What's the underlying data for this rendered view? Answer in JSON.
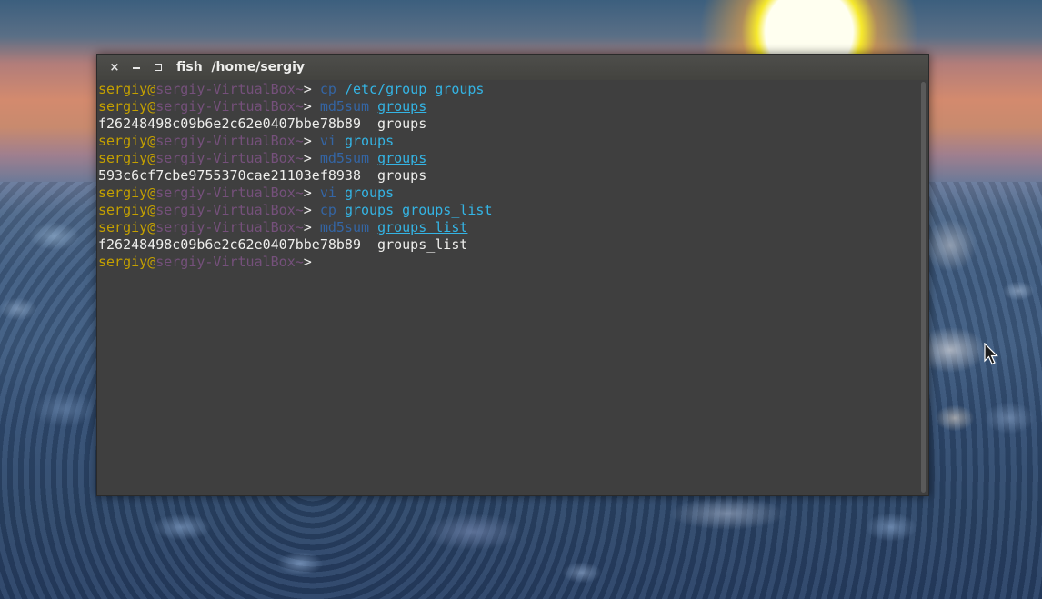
{
  "window": {
    "title_app": "fish",
    "title_path": "/home/sergiy",
    "close_label": "×"
  },
  "prompt": {
    "user": "sergiy",
    "at": "@",
    "host": "sergiy-VirtualBox",
    "tilde": "~",
    "symbol": ">"
  },
  "lines": [
    {
      "type": "cmd",
      "cmd": "cp",
      "args": [
        "/etc/group",
        "groups"
      ],
      "underline": [
        false,
        false
      ]
    },
    {
      "type": "cmd",
      "cmd": "md5sum",
      "args": [
        "groups"
      ],
      "underline": [
        true
      ]
    },
    {
      "type": "out",
      "text": "f26248498c09b6e2c62e0407bbe78b89  groups"
    },
    {
      "type": "cmd",
      "cmd": "vi",
      "args": [
        "groups"
      ],
      "underline": [
        false
      ]
    },
    {
      "type": "cmd",
      "cmd": "md5sum",
      "args": [
        "groups"
      ],
      "underline": [
        true
      ]
    },
    {
      "type": "out",
      "text": "593c6cf7cbe9755370cae21103ef8938  groups"
    },
    {
      "type": "cmd",
      "cmd": "vi",
      "args": [
        "groups"
      ],
      "underline": [
        false
      ]
    },
    {
      "type": "cmd",
      "cmd": "cp",
      "args": [
        "groups",
        "groups_list"
      ],
      "underline": [
        false,
        false
      ]
    },
    {
      "type": "cmd",
      "cmd": "md5sum",
      "args": [
        "groups_list"
      ],
      "underline": [
        true
      ]
    },
    {
      "type": "out",
      "text": "f26248498c09b6e2c62e0407bbe78b89  groups_list"
    },
    {
      "type": "prompt"
    }
  ],
  "colors": {
    "user": "#c4a000",
    "host": "#75507b",
    "command": "#3465a4",
    "argument": "#34b4e4",
    "output": "#eeeeec",
    "terminal_bg": "#3f3f3f"
  }
}
